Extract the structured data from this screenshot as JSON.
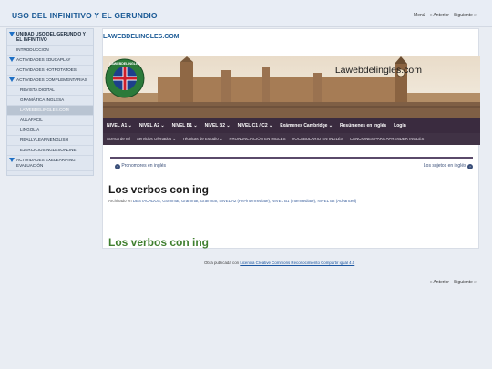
{
  "header": {
    "site_title": "USO DEL INFINITIVO Y EL GERUNDIO",
    "nav": {
      "menu": "Menú",
      "prev": "« Anterior",
      "next": "Siguiente »"
    }
  },
  "sidebar": {
    "items": [
      {
        "label": "UNIDAD USO DEL GERUNDIO Y EL INFINITIVO",
        "bold": true,
        "arrow": true,
        "sub": false
      },
      {
        "label": "INTRODUCCION",
        "bold": false,
        "arrow": false,
        "sub": false
      },
      {
        "label": "ACTIVIDADES EDUCAPLAY",
        "bold": false,
        "arrow": true,
        "sub": false
      },
      {
        "label": "ACTIVIDADES HOTPOTATOES",
        "bold": false,
        "arrow": false,
        "sub": false
      },
      {
        "label": "ACTIVIDADES COMPLEMENTARIAS",
        "bold": false,
        "arrow": true,
        "sub": false
      },
      {
        "label": "REVISTA DIGITAL",
        "bold": false,
        "arrow": false,
        "sub": true
      },
      {
        "label": "GRAMÁTICA INGLESA",
        "bold": false,
        "arrow": false,
        "sub": true
      },
      {
        "label": "LAWEBDELINGLES.COM",
        "bold": false,
        "arrow": false,
        "sub": true,
        "active": true
      },
      {
        "label": "AULAFACIL",
        "bold": false,
        "arrow": false,
        "sub": true
      },
      {
        "label": "LINGOLIA",
        "bold": false,
        "arrow": false,
        "sub": true
      },
      {
        "label": "REALLYLEARNENGLISH",
        "bold": false,
        "arrow": false,
        "sub": true
      },
      {
        "label": "EJERCICIOSINGLESONLINE",
        "bold": false,
        "arrow": false,
        "sub": true
      },
      {
        "label": "ACTIVIDADES EXELEARNING EVALUACIÓN",
        "bold": false,
        "arrow": true,
        "sub": false
      }
    ]
  },
  "main": {
    "site_name": "LAWEBDELINGLES.COM",
    "banner_text": "Lawebdelingles.com",
    "logo_text": "LAWEBDELINGLES",
    "menu_primary": [
      "NIVEL A1 ⌄",
      "NIVEL A2 ⌄",
      "NIVEL B1 ⌄",
      "NIVEL B2 ⌄",
      "NIVEL C1 / C2 ⌄",
      "Exámenes Cambridge ⌄",
      "Resúmenes en inglés",
      "Login"
    ],
    "menu_secondary": [
      "Acerca de mí",
      "Servicios Ofertados ⌄",
      "Técnicas de Estudio ⌄",
      "PRONUNCIACIÓN EN INGLÉS",
      "VOCABULARIO EN INGLÉS",
      "CANCIONES PARA APRENDER INGLÉS"
    ],
    "post_prev": "Pronombres en inglés",
    "post_next": "Los sujetos en inglés",
    "post_title": "Los verbos con ing",
    "meta": {
      "prefix": "Archivado en",
      "categories": "DESTACADOS, Grammar, Grammar, Grammar, NIVEL A2 (Pre-intermediate), NIVEL B1 (Intermediate), NIVEL B2 (Advanced)"
    },
    "green_title": "Los verbos con ing"
  },
  "footer": {
    "license_prefix": "Obra publicada con",
    "license_link": "Licencia Creative Commons Reconocimiento Compartir igual 4.0",
    "prev": "« Anterior",
    "next": "Siguiente »"
  }
}
